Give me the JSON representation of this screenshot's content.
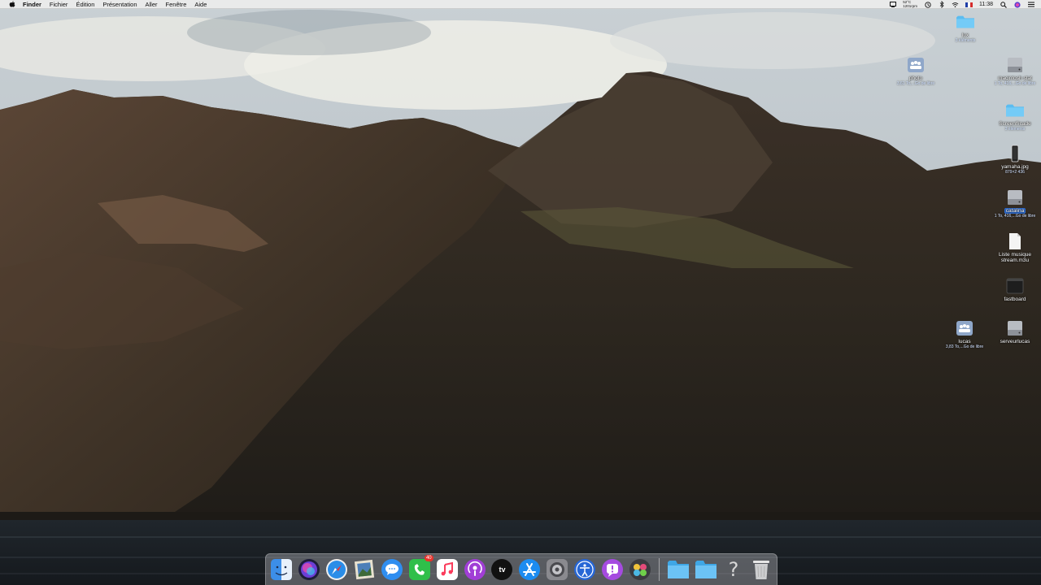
{
  "menubar": {
    "app": "Finder",
    "items": [
      "Fichier",
      "Édition",
      "Présentation",
      "Aller",
      "Fenêtre",
      "Aide"
    ],
    "status": {
      "temperature": "52°C",
      "fan": "1201rpm",
      "time": "11:38"
    }
  },
  "desktop_icons": [
    {
      "name": "lux",
      "sub": "3 éléments",
      "icon": "folder-icon"
    },
    {
      "name": "photo",
      "sub": "3,61 To,...Go de libre",
      "icon": "network-drive-icon"
    },
    {
      "name": "macintosh stat",
      "sub": "1 To, 416,...Go de libre",
      "icon": "hard-drive-icon"
    },
    {
      "name": "Screenflicade",
      "sub": "3 éléments",
      "icon": "folder-icon"
    },
    {
      "name": "yamaha.jpg",
      "sub": "879×2 436",
      "icon": "image-file-icon"
    },
    {
      "name": "catalina",
      "sub": "1 To, 416,...Go de libre",
      "icon": "hard-drive-icon"
    },
    {
      "name": "Liste musique",
      "name2": "stream.m3u",
      "icon": "document-icon"
    },
    {
      "name": "fastboard",
      "icon": "terminal-icon"
    },
    {
      "name": "lucas",
      "sub": "3,83 To,...Go de libre",
      "icon": "network-drive-icon"
    },
    {
      "name": "serveurlucas",
      "icon": "hard-drive-icon"
    }
  ],
  "dock": {
    "apps": [
      {
        "name": "Finder",
        "icon": "finder-icon"
      },
      {
        "name": "Siri",
        "icon": "siri-icon"
      },
      {
        "name": "Safari",
        "icon": "safari-icon"
      },
      {
        "name": "Aperçu",
        "icon": "preview-icon"
      },
      {
        "name": "Messages",
        "icon": "messages-icon"
      },
      {
        "name": "FaceTime",
        "icon": "facetime-icon",
        "badge": "40"
      },
      {
        "name": "Musique",
        "icon": "music-icon"
      },
      {
        "name": "Podcasts",
        "icon": "podcasts-icon"
      },
      {
        "name": "TV",
        "icon": "tv-icon",
        "label": "tv"
      },
      {
        "name": "App Store",
        "icon": "app-store-icon"
      },
      {
        "name": "Préférences Système",
        "icon": "system-preferences-icon"
      },
      {
        "name": "Accessibilité",
        "icon": "accessibility-icon"
      },
      {
        "name": "Feedback",
        "icon": "feedback-icon"
      },
      {
        "name": "Photo Booth",
        "icon": "photo-booth-icon"
      }
    ],
    "stacks": [
      {
        "name": "Applications",
        "icon": "folder-icon"
      },
      {
        "name": "Documents",
        "icon": "folder-icon"
      },
      {
        "name": "Aide",
        "icon": "help-icon",
        "label": "?"
      },
      {
        "name": "Corbeille",
        "icon": "trash-icon"
      }
    ]
  },
  "colors": {
    "menubar": "#ececec",
    "selection": "#2f6fd6",
    "folder": "#5bbcf0"
  }
}
